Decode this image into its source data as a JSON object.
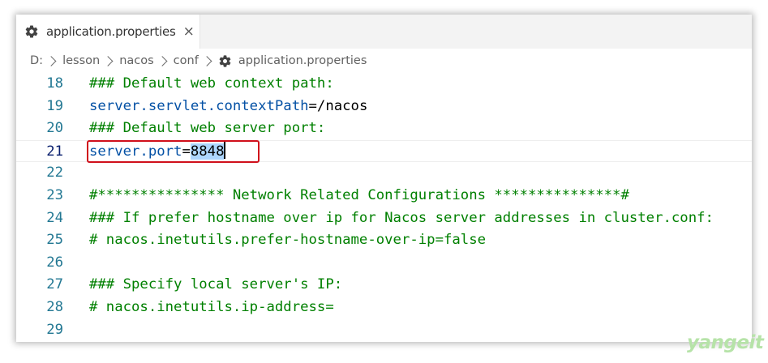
{
  "tab": {
    "label": "application.properties",
    "close_glyph": "×",
    "icon": "gear-icon"
  },
  "breadcrumb": {
    "items": [
      "D:",
      "lesson",
      "nacos",
      "conf",
      "application.properties"
    ],
    "file_icon": "gear-icon"
  },
  "editor": {
    "current_line": 21,
    "lines": [
      {
        "number": "18",
        "text": "### Default web context path:"
      },
      {
        "number": "19",
        "key": "server.servlet.contextPath",
        "eq": "=",
        "value": "/nacos"
      },
      {
        "number": "20",
        "text": "### Default web server port:"
      },
      {
        "number": "21",
        "key": "server.port",
        "eq": "=",
        "value": "8848"
      },
      {
        "number": "22",
        "text": ""
      },
      {
        "number": "23",
        "text": "#*************** Network Related Configurations ***************#"
      },
      {
        "number": "24",
        "text": "### If prefer hostname over ip for Nacos server addresses in cluster.conf:"
      },
      {
        "number": "25",
        "text": "# nacos.inetutils.prefer-hostname-over-ip=false"
      },
      {
        "number": "26",
        "text": ""
      },
      {
        "number": "27",
        "text": "### Specify local server's IP:"
      },
      {
        "number": "28",
        "text": "# nacos.inetutils.ip-address="
      },
      {
        "number": "29",
        "text": ""
      }
    ]
  },
  "watermark": "yangeit",
  "colors": {
    "comment": "#008000",
    "key": "#0451a5",
    "line_number": "#237893",
    "highlight_box": "#d0101b",
    "selection": "#add6ff"
  }
}
